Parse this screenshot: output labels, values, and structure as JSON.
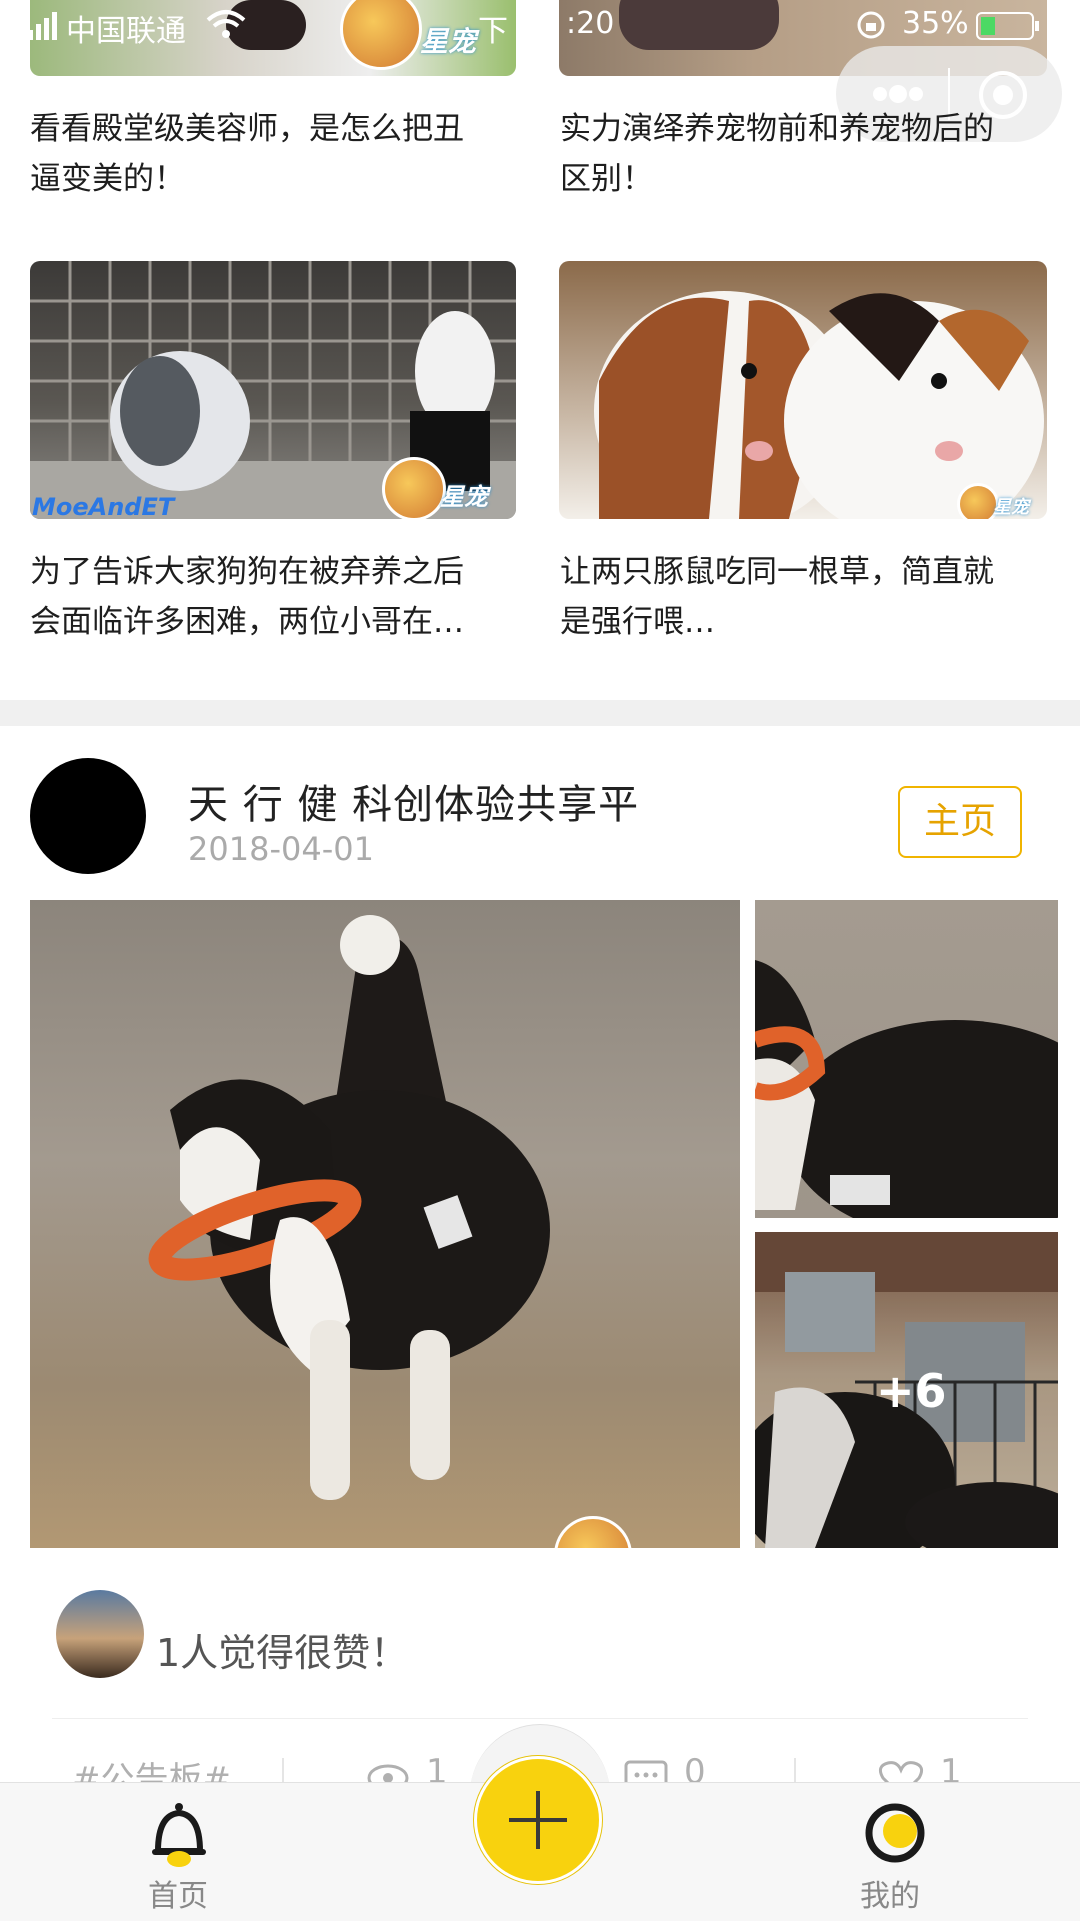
{
  "status_bar": {
    "carrier": "中国联通",
    "time_fragment": ":20",
    "time_hidden": "下",
    "battery": "35%"
  },
  "video_grid": {
    "watermark": "星宠",
    "items": [
      {
        "title_line1": "看看殿堂级美容师，是怎么把丑",
        "title_line2": "逼变美的！"
      },
      {
        "title_line1": "实力演绎养宠物前和养宠物后的",
        "title_line2": "区别！"
      },
      {
        "title_line1": "为了告诉大家狗狗在被弃养之后",
        "title_line2": "会面临许多困难，两位小哥在…",
        "overlay_text": "MoeAndET"
      },
      {
        "title_line1": "让两只豚鼠吃同一根草，简直就",
        "title_line2": "是强行喂…"
      }
    ]
  },
  "post": {
    "author": "天 行 健 科创体验共享平",
    "date": "2018-04-01",
    "home_label": "主页",
    "more_photos": "+6",
    "likes_text": "1人觉得很赞！",
    "tag": "#公告板#",
    "views": "1",
    "comments": "0",
    "likes": "1"
  },
  "tabbar": {
    "home": "首页",
    "mine": "我的"
  },
  "colors": {
    "accent_yellow": "#f8d20e",
    "home_button_border": "#f0b400",
    "battery_green": "#4cd964"
  },
  "icons": [
    "wifi-icon",
    "signal-icon",
    "lock-icon",
    "battery-icon",
    "more-dots-icon",
    "record-icon",
    "bell-icon",
    "plus-icon",
    "profile-icon",
    "eye-icon",
    "comment-icon",
    "heart-icon"
  ]
}
